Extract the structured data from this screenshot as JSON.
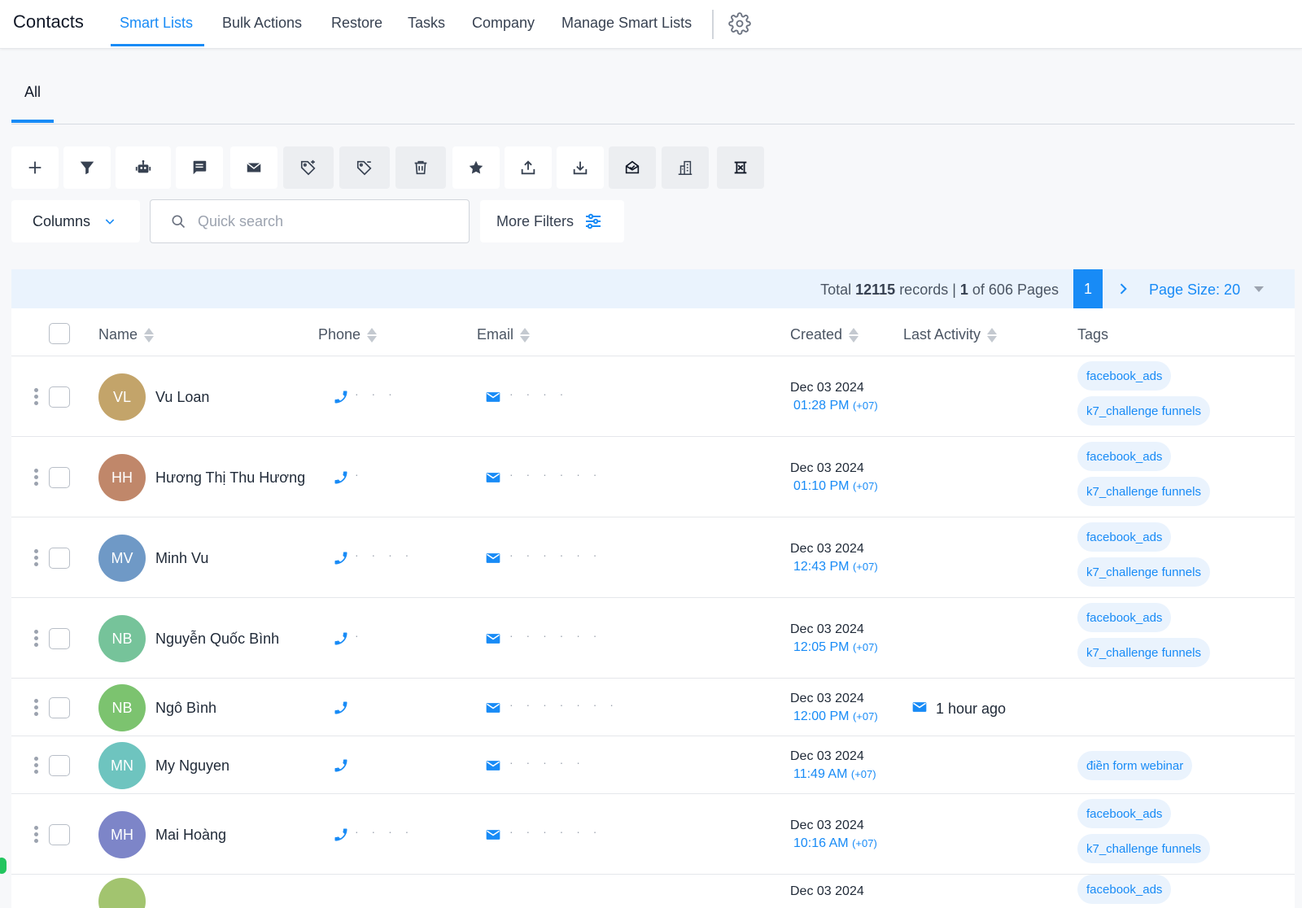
{
  "nav": {
    "brand": "Contacts",
    "items": [
      "Smart Lists",
      "Bulk Actions",
      "Restore",
      "Tasks",
      "Company",
      "Manage Smart Lists"
    ],
    "active": "Smart Lists"
  },
  "subtabs": {
    "all": "All"
  },
  "toolbar": {
    "icons": [
      "plus-icon",
      "filter-icon",
      "robot-icon",
      "message-icon",
      "email-icon",
      "tag-add-icon",
      "tag-remove-icon",
      "trash-icon",
      "star-icon",
      "export-icon",
      "import-icon",
      "mail-check-icon",
      "building-icon",
      "merge-icon"
    ]
  },
  "filters": {
    "columns_label": "Columns",
    "search_placeholder": "Quick search",
    "more_filters_label": "More Filters"
  },
  "pager": {
    "total_prefix": "Total ",
    "total_records": "12115",
    "total_mid": " records | ",
    "current_page": "1",
    "of_pages": " of 606 Pages",
    "page_button": "1",
    "page_size_label": "Page Size: 20"
  },
  "columns": {
    "name": "Name",
    "phone": "Phone",
    "email": "Email",
    "created": "Created",
    "last_activity": "Last Activity",
    "tags": "Tags"
  },
  "contacts": [
    {
      "initials": "VL",
      "name": "Vu Loan",
      "avatar_color": "#c3a46a",
      "phone": "· · ·",
      "email": "· · · ·",
      "date": "Dec 03 2024",
      "time": "01:28 PM",
      "tz": "(+07)",
      "activity": "",
      "tags": [
        "facebook_ads",
        "k7_challenge funnels"
      ]
    },
    {
      "initials": "HH",
      "name": "Hương Thị Thu Hương",
      "avatar_color": "#c0876a",
      "phone": "·",
      "email": "· · · · · ·",
      "date": "Dec 03 2024",
      "time": "01:10 PM",
      "tz": "(+07)",
      "activity": "",
      "tags": [
        "facebook_ads",
        "k7_challenge funnels"
      ]
    },
    {
      "initials": "MV",
      "name": "Minh Vu",
      "avatar_color": "#6f99c6",
      "phone": "· · · ·",
      "email": "· · · · · ·",
      "date": "Dec 03 2024",
      "time": "12:43 PM",
      "tz": "(+07)",
      "activity": "",
      "tags": [
        "facebook_ads",
        "k7_challenge funnels"
      ]
    },
    {
      "initials": "NB",
      "name": "Nguyễn Quốc Bình",
      "avatar_color": "#76c39a",
      "phone": "·",
      "email": "· · · · · ·",
      "date": "Dec 03 2024",
      "time": "12:05 PM",
      "tz": "(+07)",
      "activity": "",
      "tags": [
        "facebook_ads",
        "k7_challenge funnels"
      ]
    },
    {
      "initials": "NB",
      "name": "Ngô Bình",
      "avatar_color": "#7cc36f",
      "phone": "",
      "email": "· · · · · · ·",
      "date": "Dec 03 2024",
      "time": "12:00 PM",
      "tz": "(+07)",
      "activity": "1 hour ago",
      "tags": []
    },
    {
      "initials": "MN",
      "name": "My Nguyen",
      "avatar_color": "#6ec4bf",
      "phone": "",
      "email": "· · · · ·",
      "date": "Dec 03 2024",
      "time": "11:49 AM",
      "tz": "(+07)",
      "activity": "",
      "tags": [
        "điền form webinar"
      ]
    },
    {
      "initials": "MH",
      "name": "Mai Hoàng",
      "avatar_color": "#7d85c8",
      "phone": "· · · ·",
      "email": "· · · · · ·",
      "date": "Dec 03 2024",
      "time": "10:16 AM",
      "tz": "(+07)",
      "activity": "",
      "tags": [
        "facebook_ads",
        "k7_challenge funnels"
      ]
    },
    {
      "initials": "",
      "name": "",
      "avatar_color": "#a2c46f",
      "phone": "",
      "email": "",
      "date": "Dec 03 2024",
      "time": "",
      "tz": "",
      "activity": "",
      "tags": [
        "facebook_ads"
      ]
    }
  ],
  "colors": {
    "accent": "#188bf6",
    "tag_bg": "#eaf3fd",
    "pager_bg": "#eaf3fd"
  }
}
